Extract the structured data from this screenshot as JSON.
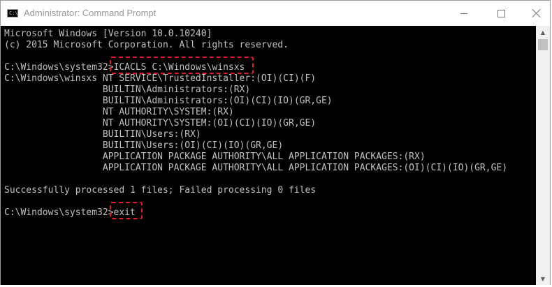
{
  "window": {
    "title": "Administrator: Command Prompt",
    "icon_glyph": "C:\\"
  },
  "controls": {
    "minimize_icon": "minimize-icon",
    "maximize_icon": "maximize-icon",
    "close_icon": "close-icon"
  },
  "console": {
    "lines": [
      "Microsoft Windows [Version 10.0.10240]",
      "(c) 2015 Microsoft Corporation. All rights reserved.",
      "",
      "C:\\Windows\\system32>ICACLS C:\\Windows\\winsxs",
      "C:\\Windows\\winsxs NT SERVICE\\TrustedInstaller:(OI)(CI)(F)",
      "                  BUILTIN\\Administrators:(RX)",
      "                  BUILTIN\\Administrators:(OI)(CI)(IO)(GR,GE)",
      "                  NT AUTHORITY\\SYSTEM:(RX)",
      "                  NT AUTHORITY\\SYSTEM:(OI)(CI)(IO)(GR,GE)",
      "                  BUILTIN\\Users:(RX)",
      "                  BUILTIN\\Users:(OI)(CI)(IO)(GR,GE)",
      "                  APPLICATION PACKAGE AUTHORITY\\ALL APPLICATION PACKAGES:(RX)",
      "                  APPLICATION PACKAGE AUTHORITY\\ALL APPLICATION PACKAGES:(OI)(CI)(IO)(GR,GE)",
      "",
      "Successfully processed 1 files; Failed processing 0 files",
      "",
      "C:\\Windows\\system32>exit"
    ],
    "text_color": "#c0c0c0",
    "background": "#000000",
    "highlight_color": "#e8192c"
  },
  "scrollbar": {
    "up_arrow": "▲",
    "down_arrow": "▼"
  }
}
